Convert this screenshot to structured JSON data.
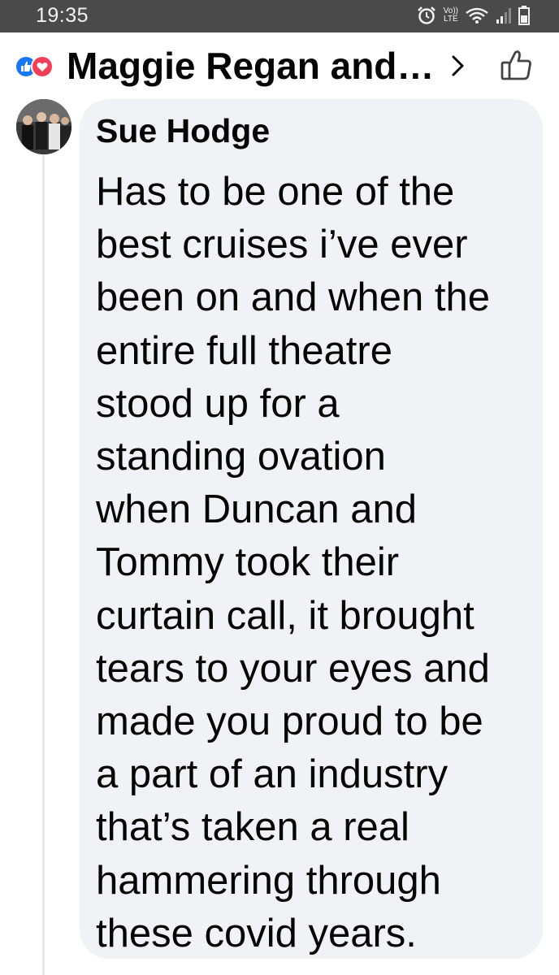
{
  "status_bar": {
    "time": "19:35",
    "network_top": "Vo))",
    "network_bottom": "LTE",
    "icons": [
      "alarm-icon",
      "volte-lte-icon",
      "wifi-icon",
      "signal-icon",
      "battery-icon"
    ]
  },
  "header": {
    "title": "Maggie Regan and…",
    "reactions": [
      "like-reaction-icon",
      "love-reaction-icon"
    ],
    "chevron_icon": "chevron-right-icon",
    "like_icon": "thumbs-up-outline-icon"
  },
  "comment": {
    "author": "Sue Hodge",
    "text": "Has to be one of the\nbest cruises i’ve ever\nbeen on and when the\nentire full theatre\nstood up for a\nstanding ovation\nwhen Duncan and\nTommy took their\ncurtain call, it brought\ntears to your eyes and\nmade you proud to be\na part of an industry\nthat’s taken a real\nhammering through\nthese covid years."
  },
  "colors": {
    "status_bar_bg": "#4a4a4a",
    "bubble_bg": "#f0f2f5",
    "like_blue": "#1877f2",
    "love_red": "#f33e58",
    "text": "#050505"
  }
}
